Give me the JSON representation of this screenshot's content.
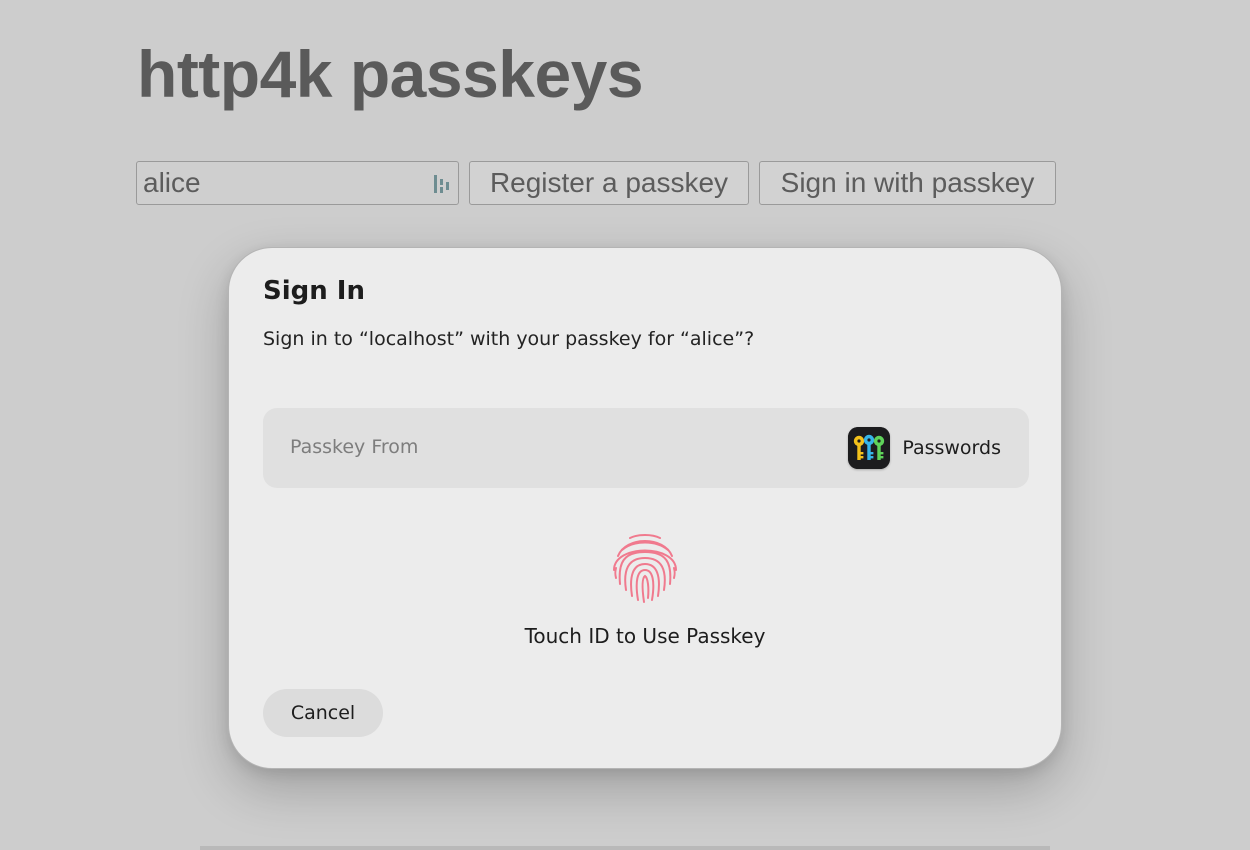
{
  "page": {
    "title": "http4k passkeys",
    "username_value": "alice",
    "register_label": "Register a passkey",
    "signin_label": "Sign in with passkey"
  },
  "dialog": {
    "title": "Sign In",
    "message": "Sign in to “localhost” with your passkey for “alice”?",
    "source_label": "Passkey From",
    "source_provider": "Passwords",
    "source_provider_icon": "passwords-app-icon",
    "touchid_label": "Touch ID to Use Passkey",
    "touchid_icon": "fingerprint-icon",
    "cancel_label": "Cancel"
  },
  "colors": {
    "page_background": "#cdcdcd",
    "dialog_background": "#ececec",
    "fingerprint": "#f07a8e"
  }
}
